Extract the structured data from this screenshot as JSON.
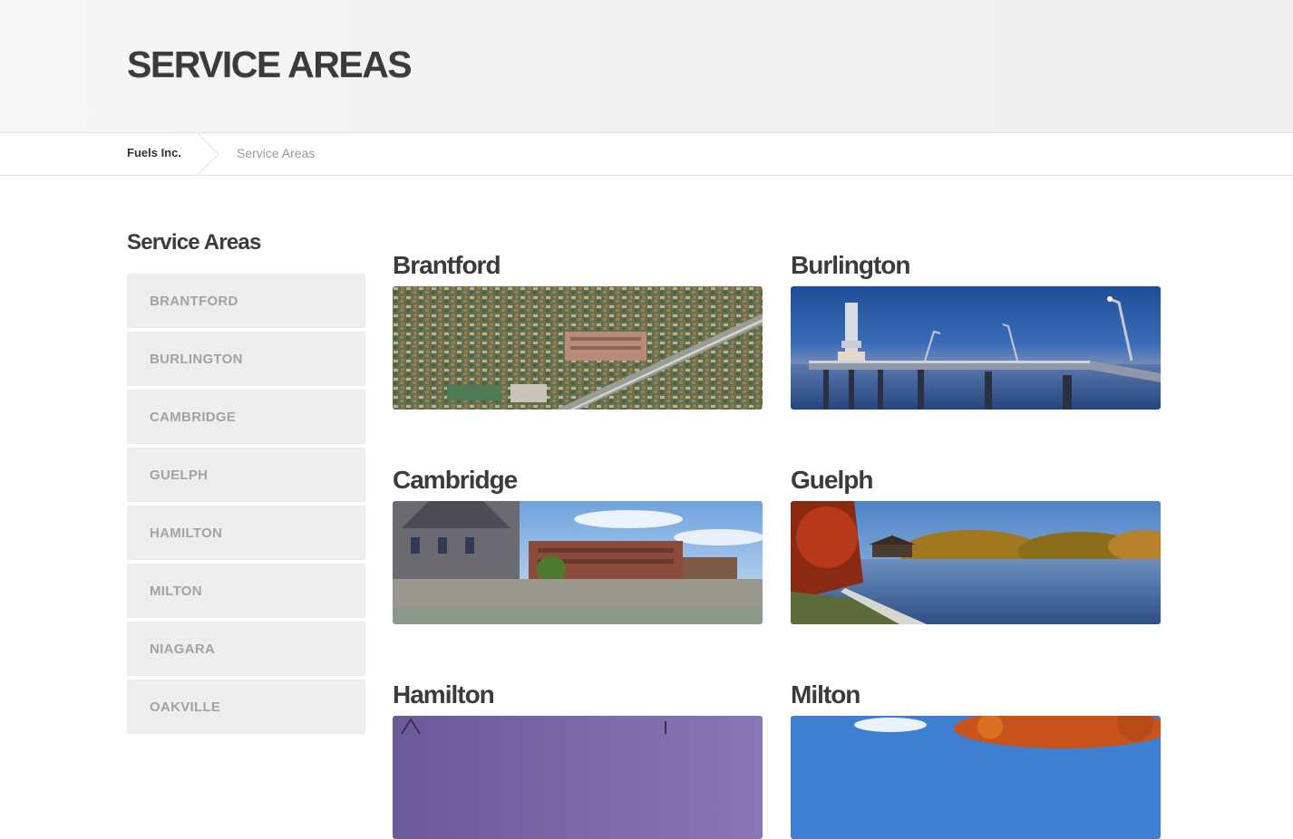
{
  "hero": {
    "title": "SERVICE AREAS"
  },
  "breadcrumb": {
    "home": "Fuels Inc.",
    "current": "Service Areas"
  },
  "sidebar": {
    "title": "Service Areas",
    "items": [
      {
        "label": "BRANTFORD"
      },
      {
        "label": "BURLINGTON"
      },
      {
        "label": "CAMBRIDGE"
      },
      {
        "label": "GUELPH"
      },
      {
        "label": "HAMILTON"
      },
      {
        "label": "MILTON"
      },
      {
        "label": "NIAGARA"
      },
      {
        "label": "OAKVILLE"
      }
    ]
  },
  "areas": [
    {
      "name": "Brantford"
    },
    {
      "name": "Burlington"
    },
    {
      "name": "Cambridge"
    },
    {
      "name": "Guelph"
    },
    {
      "name": "Hamilton"
    },
    {
      "name": "Milton"
    }
  ],
  "colors": {
    "hero_bg": "#f2f2f2",
    "heading": "#3b3b3b",
    "sidebar_item_bg": "#eeeeee",
    "sidebar_item_text": "#a3a3a3",
    "breadcrumb_current": "#9a9a9a"
  }
}
